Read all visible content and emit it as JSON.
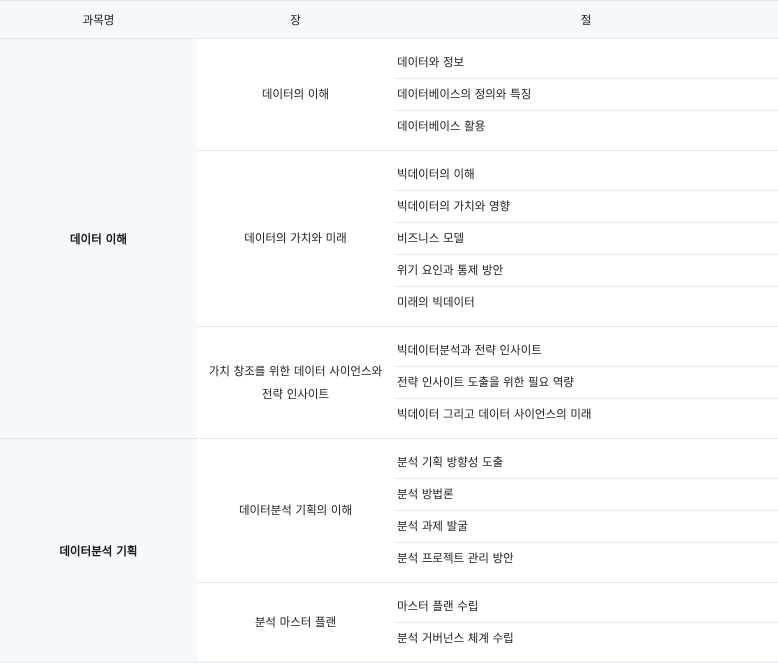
{
  "header": {
    "col1": "과목명",
    "col2": "장",
    "col3": "절"
  },
  "subjects": [
    {
      "name": "데이터 이해",
      "chapters": [
        {
          "title": "데이터의 이해",
          "sections": [
            "데이터와 정보",
            "데이터베이스의 정의와 특징",
            "데이터베이스 활용"
          ]
        },
        {
          "title": "데이터의 가치와 미래",
          "sections": [
            "빅데이터의 이해",
            "빅데이터의 가치와 영향",
            "비즈니스 모델",
            "위기 요인과 통제 방안",
            "미래의 빅데이터"
          ]
        },
        {
          "title": "가치 창조를 위한 데이터 사이언스와 전략 인사이트",
          "sections": [
            "빅데이터분석과 전략 인사이트",
            "전략 인사이트 도출을 위한 필요 역량",
            "빅데이터 그리고 데이터 사이언스의 미래"
          ]
        }
      ]
    },
    {
      "name": "데이터분석 기획",
      "chapters": [
        {
          "title": "데이터분석 기획의 이해",
          "sections": [
            "분석 기획 방향성 도출",
            "분석 방법론",
            "분석 과제 발굴",
            "분석 프로젝트 관리 방안"
          ]
        },
        {
          "title": "분석 마스터 플랜",
          "sections": [
            "마스터 플랜 수립",
            "분석 거버넌스 체계 수립"
          ]
        }
      ]
    }
  ]
}
